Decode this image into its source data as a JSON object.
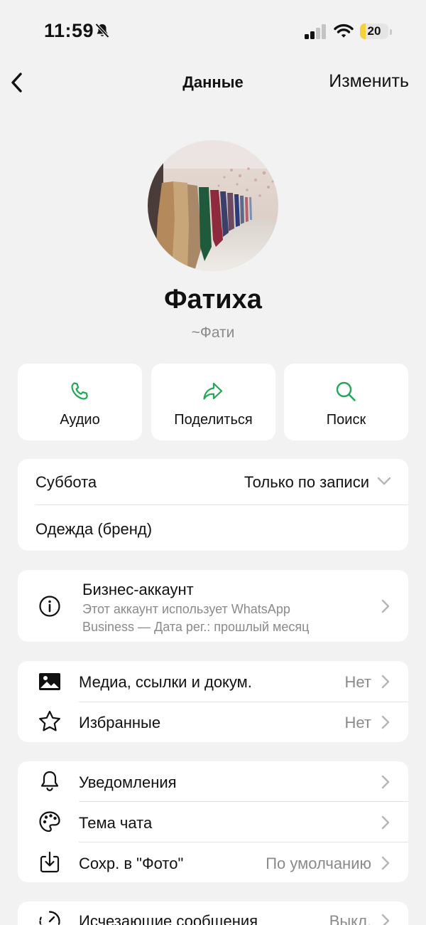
{
  "status_bar": {
    "time": "11:59",
    "battery": "20",
    "battery_level": 0.2,
    "icons": [
      "bell-slash-icon",
      "signal-icon",
      "wifi-icon",
      "battery-icon"
    ]
  },
  "nav": {
    "title": "Данные",
    "edit_label": "Изменить",
    "back_icon": "chevron-left-icon"
  },
  "profile": {
    "name": "Фатиха",
    "nickname": "~Фати"
  },
  "actions": [
    {
      "label": "Аудио",
      "icon": "phone-icon"
    },
    {
      "label": "Поделиться",
      "icon": "share-arrow-icon"
    },
    {
      "label": "Поиск",
      "icon": "search-icon"
    }
  ],
  "business_info": {
    "hours_day": "Суббота",
    "hours_value": "Только по записи",
    "category": "Одежда (бренд)"
  },
  "business_account": {
    "title": "Бизнес-аккаунт",
    "description_line1": "Этот аккаунт использует WhatsApp",
    "description_line2": "Business — Дата рег.: прошлый месяц"
  },
  "media_section": [
    {
      "label": "Медиа, ссылки и докум.",
      "value": "Нет",
      "icon": "image-icon"
    },
    {
      "label": "Избранные",
      "value": "Нет",
      "icon": "star-icon"
    }
  ],
  "settings_section": [
    {
      "label": "Уведомления",
      "value": "",
      "icon": "bell-icon"
    },
    {
      "label": "Тема чата",
      "value": "",
      "icon": "palette-icon"
    },
    {
      "label": "Сохр. в \"Фото\"",
      "value": "По умолчанию",
      "icon": "download-icon"
    }
  ],
  "disappearing": {
    "label": "Исчезающие сообщения",
    "value": "Выкл.",
    "icon": "timer-icon"
  },
  "colors": {
    "accent_green": "#1fa855",
    "background": "#f2f2f2",
    "battery_yellow": "#f6d23a"
  }
}
